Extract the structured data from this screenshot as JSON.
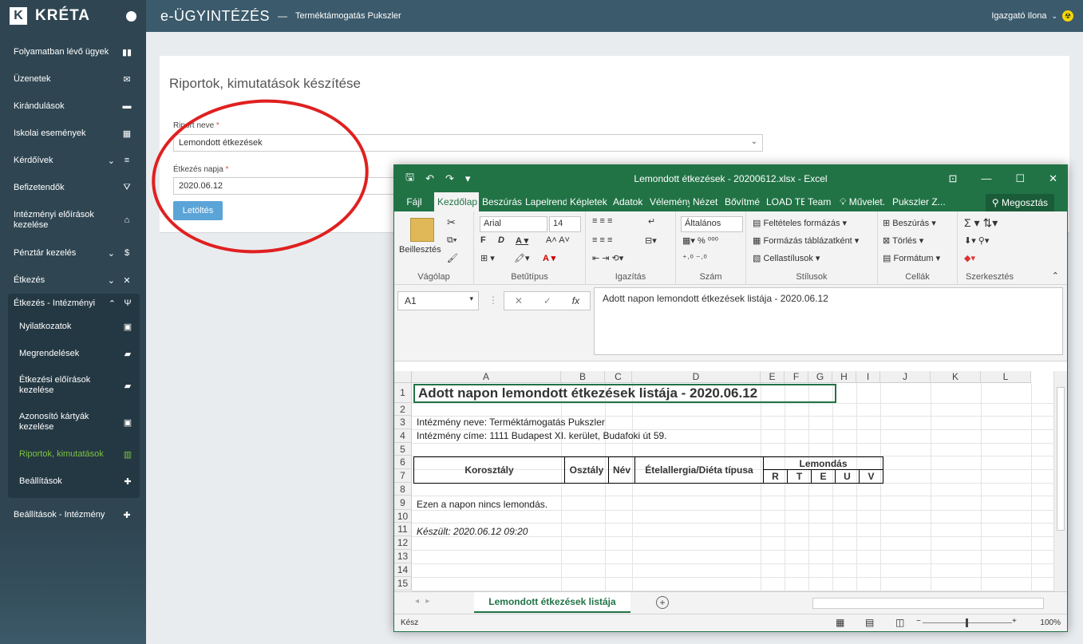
{
  "sidebar": {
    "logo_mark": "K",
    "logo_text": "KRÉTA",
    "items": [
      {
        "label": "Folyamatban lévő ügyek",
        "icon": "▮▮"
      },
      {
        "label": "Üzenetek",
        "icon": "✉"
      },
      {
        "label": "Kirándulások",
        "icon": "▬"
      },
      {
        "label": "Iskolai események",
        "icon": "▦"
      },
      {
        "label": "Kérdőívek",
        "icon": "≡"
      },
      {
        "label": "Befizetendők",
        "icon": "⛛"
      },
      {
        "label": "Intézményi előírások kezelése",
        "icon": "⌂"
      },
      {
        "label": "Pénztár kezelés",
        "icon": "$"
      },
      {
        "label": "Étkezés",
        "icon": "✕"
      }
    ],
    "group": {
      "label": "Étkezés - Intézményi",
      "icon": "Ψ",
      "items": [
        {
          "label": "Nyilatkozatok",
          "icon": "▣"
        },
        {
          "label": "Megrendelések",
          "icon": "▰"
        },
        {
          "label": "Étkezési előírások kezelése",
          "icon": "▰"
        },
        {
          "label": "Azonosító kártyák kezelése",
          "icon": "▣"
        },
        {
          "label": "Riportok, kimutatások",
          "icon": "▥"
        },
        {
          "label": "Beállítások",
          "icon": "✚"
        }
      ]
    },
    "last_item": {
      "label": "Beállítások - Intézmény",
      "icon": "✚"
    }
  },
  "topbar": {
    "app_title": "e-ÜGYINTÉZÉS",
    "separator": "—",
    "institution": "Terméktámogatás Pukszler",
    "user": "Igazgató Ilona",
    "user_chevron": "⌄",
    "user_icon": "☢"
  },
  "page": {
    "title": "Riportok, kimutatások készítése",
    "report_label": "Riport neve",
    "report_value": "Lemondott étkezések",
    "date_label": "Étkezés napja",
    "date_value": "2020.06.12",
    "required_mark": "*",
    "download_label": "Letöltés"
  },
  "excel": {
    "filename": "Lemondott étkezések - 20200612.xlsx - Excel",
    "tabs": [
      "Fájl",
      "Kezdőlap",
      "Beszúrás",
      "Lapelrend",
      "Képletek",
      "Adatok",
      "Vélemény",
      "Nézet",
      "Bővítmé",
      "LOAD TE",
      "Team",
      "Művelet.",
      "Pukszler Z..."
    ],
    "share": "Megosztás",
    "ribbon": {
      "paste": "Beillesztés",
      "clipboard": "Vágólap",
      "font_name": "Arial",
      "font_size": "14",
      "font_group": "Betűtípus",
      "alignment": "Igazítás",
      "number_format": "Általános",
      "number": "Szám",
      "cond_format": "Feltételes formázás",
      "format_table": "Formázás táblázatként",
      "cell_styles": "Cellastílusok",
      "styles": "Stílusok",
      "insert": "Beszúrás",
      "delete": "Törlés",
      "format": "Formátum",
      "cells": "Cellák",
      "editing": "Szerkesztés"
    },
    "name_box": "A1",
    "formula": "Adott napon lemondott étkezések listája - 2020.06.12",
    "columns": [
      "A",
      "B",
      "C",
      "D",
      "E",
      "F",
      "G",
      "H",
      "I",
      "J",
      "K",
      "L"
    ],
    "rows": [
      "1",
      "2",
      "3",
      "4",
      "5",
      "6",
      "7",
      "8",
      "9",
      "10",
      "11",
      "12",
      "13",
      "14",
      "15"
    ],
    "sheet": {
      "a1": "Adott napon lemondott étkezések listája - 2020.06.12",
      "a3": "Intézmény neve: Terméktámogatás Pukszler",
      "a4": "Intézmény címe: 1111 Budapest XI. kerület, Budafoki út 59.",
      "h_korosztaly": "Korosztály",
      "h_osztaly": "Osztály",
      "h_nev": "Név",
      "h_allergia": "Ételallergia/Diéta típusa",
      "h_lemondas": "Lemondás",
      "h_r": "R",
      "h_t": "T",
      "h_e": "E",
      "h_u": "U",
      "h_v": "V",
      "a9": "Ezen a napon nincs lemondás.",
      "a11": "Készült: 2020.06.12 09:20"
    },
    "sheet_tab": "Lemondott étkezések listája",
    "status": "Kész",
    "zoom": "100%"
  }
}
